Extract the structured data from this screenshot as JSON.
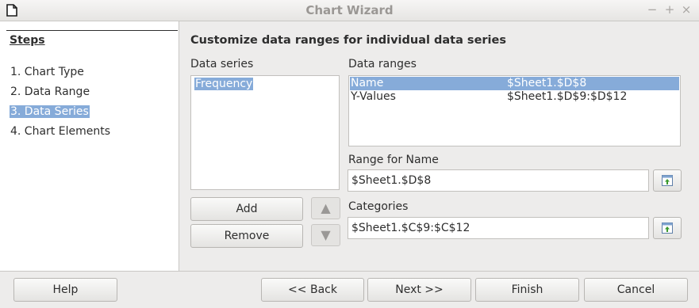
{
  "window": {
    "title": "Chart Wizard",
    "controls": [
      "−",
      "+",
      "×"
    ]
  },
  "steps": {
    "title": "Steps",
    "items": [
      {
        "label": "1. Chart Type",
        "selected": false
      },
      {
        "label": "2. Data Range",
        "selected": false
      },
      {
        "label": "3. Data Series",
        "selected": true
      },
      {
        "label": "4. Chart Elements",
        "selected": false
      }
    ]
  },
  "main": {
    "heading": "Customize data ranges for individual data series",
    "data_series": {
      "label": "Data series",
      "items": [
        "Frequency"
      ]
    },
    "data_ranges": {
      "label": "Data ranges",
      "rows": [
        {
          "name": "Name",
          "range": "$Sheet1.$D$8",
          "selected": true
        },
        {
          "name": "Y-Values",
          "range": "$Sheet1.$D$9:$D$12",
          "selected": false
        }
      ]
    },
    "range_for_name": {
      "label": "Range for Name",
      "value": "$Sheet1.$D$8"
    },
    "categories": {
      "label": "Categories",
      "value": "$Sheet1.$C$9:$C$12"
    },
    "add_label": "Add",
    "remove_label": "Remove",
    "move_up_icon": "triangle-up",
    "move_down_icon": "triangle-down"
  },
  "footer": {
    "help_label": "Help",
    "back_label": "<< Back",
    "next_label": "Next >>",
    "finish_label": "Finish",
    "cancel_label": "Cancel"
  }
}
